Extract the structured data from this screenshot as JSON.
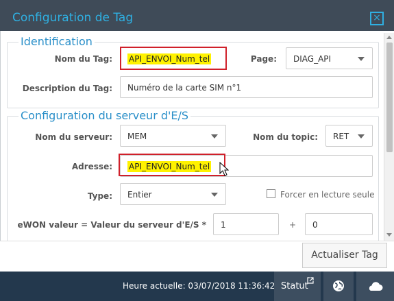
{
  "window": {
    "title": "Configuration de Tag",
    "close_glyph": "×"
  },
  "identification": {
    "legend": "Identification",
    "tag_name_label": "Nom du Tag:",
    "tag_name_value": "API_ENVOI_Num_tel",
    "page_label": "Page:",
    "page_value": "DIAG_API",
    "description_label": "Description du Tag:",
    "description_value": "Numéro de la carte SIM n°1"
  },
  "io_server": {
    "legend": "Configuration du serveur d'E/S",
    "server_name_label": "Nom du serveur:",
    "server_name_value": "MEM",
    "topic_label": "Nom du topic:",
    "topic_value": "RET",
    "address_label": "Adresse:",
    "address_value": "API_ENVOI_Num_tel",
    "type_label": "Type:",
    "type_value": "Entier",
    "readonly_label": "Forcer en lecture seule",
    "readonly_checked": false,
    "ewon_label": "eWON valeur = Valeur du serveur d'E/S *",
    "multiplier_value": "1",
    "plus_sign": "+",
    "offset_value": "0"
  },
  "actions": {
    "update_label": "Actualiser Tag"
  },
  "statusbar": {
    "clock": "Heure actuelle: 03/07/2018 11:36:42",
    "statut_label": "Statut"
  },
  "colors": {
    "accent": "#2fb0e2",
    "highlight": "#fff200",
    "annotation_box": "#d0202a",
    "statusbar": "#23384d"
  },
  "icons": [
    "close-icon",
    "chevron-down-icon",
    "external-link-icon",
    "globe-icon",
    "cloud-icon",
    "mouse-cursor-icon"
  ]
}
